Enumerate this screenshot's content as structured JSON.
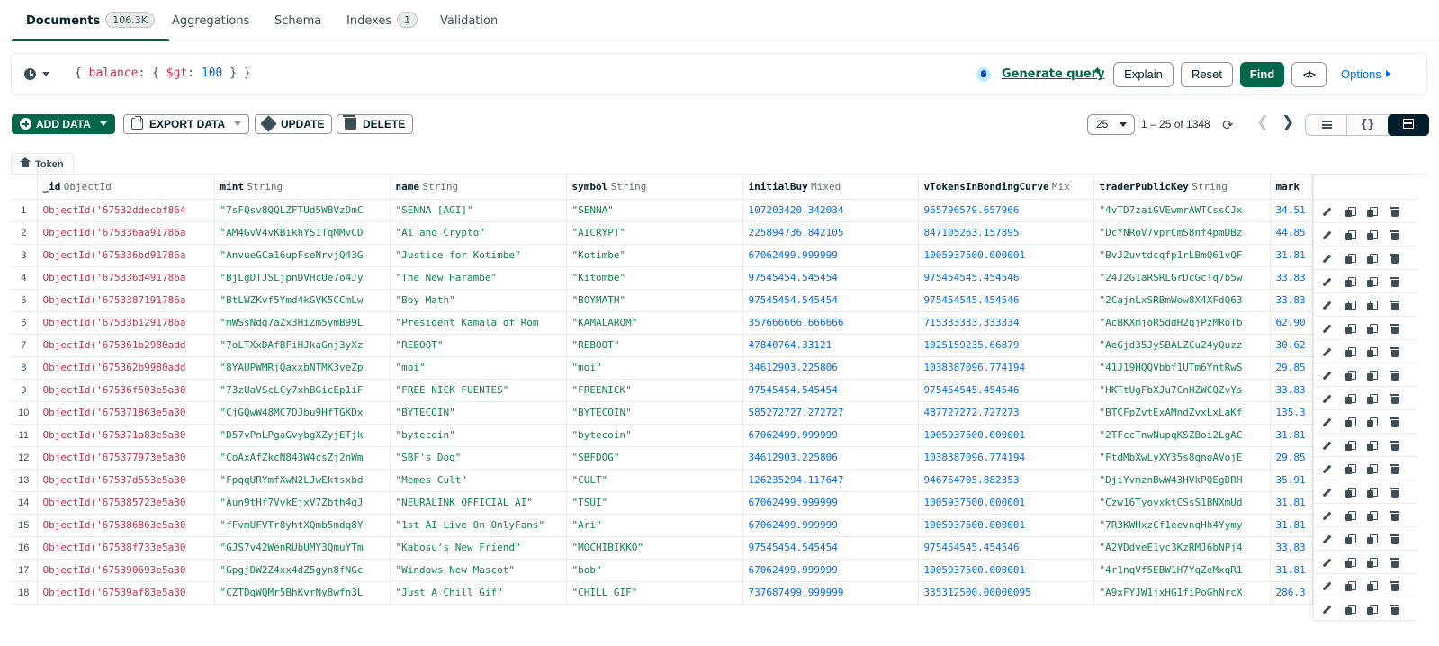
{
  "tabs": [
    {
      "label": "Documents",
      "count": "106.3K"
    },
    {
      "label": "Aggregations"
    },
    {
      "label": "Schema"
    },
    {
      "label": "Indexes",
      "count": "1"
    },
    {
      "label": "Validation"
    }
  ],
  "query": {
    "open": "{ ",
    "field": "balance",
    "colon": ": { ",
    "op": "$gt",
    "colon2": ": ",
    "value": "100",
    "close": " } }",
    "generate_label": "Generate query",
    "explain_label": "Explain",
    "reset_label": "Reset",
    "find_label": "Find",
    "options_label": "Options"
  },
  "toolbar": {
    "add_label": "ADD DATA",
    "export_label": "EXPORT DATA",
    "update_label": "UPDATE",
    "delete_label": "DELETE",
    "page_size": "25",
    "range": "1 – 25 of 1348"
  },
  "breadcrumb": "Token",
  "columns": [
    {
      "field": "_id",
      "type": "ObjectId"
    },
    {
      "field": "mint",
      "type": "String"
    },
    {
      "field": "name",
      "type": "String"
    },
    {
      "field": "symbol",
      "type": "String"
    },
    {
      "field": "initialBuy",
      "type": "Mixed"
    },
    {
      "field": "vTokensInBondingCurve",
      "type": "Mix"
    },
    {
      "field": "traderPublicKey",
      "type": "String"
    },
    {
      "field": "mark",
      "type": ""
    }
  ],
  "rows": [
    [
      "1",
      "ObjectId('67532ddecbf864",
      "\"7sFQsv8QQLZFTUd5WBVzDmC",
      "\"SENNA [AGI]\"",
      "\"SENNA\"",
      "107203420.342034",
      "965796579.657966",
      "\"4vTD7zaiGVEwmrAWTCssCJx",
      "34.51"
    ],
    [
      "2",
      "ObjectId('675336aa91786a",
      "\"AM4GvV4vKBikhYS1TqMMvCD",
      "\"AI and Crypto\"",
      "\"AICRYPT\"",
      "225894736.842105",
      "847105263.157895",
      "\"DcYNRoV7vprCmS8nf4pmDBz",
      "44.85"
    ],
    [
      "3",
      "ObjectId('675336bd91786a",
      "\"AnvueGCa16upFseNrvjQ43G",
      "\"Justice for Kotimbe\"",
      "\"Kotimbe\"",
      "67062499.999999",
      "1005937500.000001",
      "\"BvJ2uvtdcqfp1rLBmQ61vQF",
      "31.81"
    ],
    [
      "4",
      "ObjectId('675336d491786a",
      "\"BjLgDTJSLjpnDVHcUe7o4Jy",
      "\"The New Harambe\"",
      "\"Kitombe\"",
      "97545454.545454",
      "975454545.454546",
      "\"24J2G1aRSRLGrDcGcTq7b5w",
      "33.83"
    ],
    [
      "5",
      "ObjectId('6753387191786a",
      "\"BtLWZKvf5Ymd4kGVK5CCmLw",
      "\"Boy Math\"",
      "\"BOYMATH\"",
      "97545454.545454",
      "975454545.454546",
      "\"2CajnLxSRBmWow8X4XFdQ63",
      "33.83"
    ],
    [
      "6",
      "ObjectId('67533b1291786a",
      "\"mWSsNdg7aZx3HiZm5ymB99L",
      "\"President Kamala of Rom",
      "\"KAMALAROM\"",
      "357666666.666666",
      "715333333.333334",
      "\"AcBKXmjoR5ddH2qjPzMRoTb",
      "62.90"
    ],
    [
      "7",
      "ObjectId('675361b2980add",
      "\"7oLTXxDAfBFiHJkaGnj3yXz",
      "\"REBOOT\"",
      "\"REBOOT\"",
      "47840764.33121",
      "1025159235.66879",
      "\"AeGjd35JySBALZCu24yQuzz",
      "30.62"
    ],
    [
      "8",
      "ObjectId('675362b9980add",
      "\"8YAUPWMRjQaxxbNTMK3veZp",
      "\"moi\"",
      "\"moi\"",
      "34612903.225806",
      "1038387096.774194",
      "\"41J19HQQVbbf1UTm6YntRwS",
      "29.85"
    ],
    [
      "9",
      "ObjectId('67536f503e5a30",
      "\"73zUaVScLCy7xhBGicEp1iF",
      "\"FREE NICK FUENTES\"",
      "\"FREENICK\"",
      "97545454.545454",
      "975454545.454546",
      "\"HKTtUgFbXJu7CnHZWCQZvYs",
      "33.83"
    ],
    [
      "10",
      "ObjectId('675371863e5a30",
      "\"CjGQwW48MC7DJbu9HfTGKDx",
      "\"BYTECOIN\"",
      "\"BYTECOIN\"",
      "585272727.272727",
      "487727272.727273",
      "\"BTCFpZvtExAMndZvxLxLaKf",
      "135.3"
    ],
    [
      "11",
      "ObjectId('675371a83e5a30",
      "\"D57vPnLPgaGvybgXZyjETjk",
      "\"bytecoin\"",
      "\"bytecoin\"",
      "67062499.999999",
      "1005937500.000001",
      "\"2TFccTnwNupqKSZBoi2LgAC",
      "31.81"
    ],
    [
      "12",
      "ObjectId('675377973e5a30",
      "\"CoAxAfZkcN843W4csZj2nWm",
      "\"SBF's Dog\"",
      "\"SBFDOG\"",
      "34612903.225806",
      "1038387096.774194",
      "\"FtdMbXwLyXY35s8gnoAVojE",
      "29.85"
    ],
    [
      "13",
      "ObjectId('67537d553e5a30",
      "\"FpqqURYmfXwN2LJwEktsxbd",
      "\"Memes Cult\"",
      "\"CULT\"",
      "126235294.117647",
      "946764705.882353",
      "\"DjiYvmznBwW43HVkPQEgDRH",
      "35.91"
    ],
    [
      "14",
      "ObjectId('675385723e5a30",
      "\"Aun9tHf7VvkEjxV7Zbth4gJ",
      "\"NEURALINK OFFICIAL AI\"",
      "\"TSUI\"",
      "67062499.999999",
      "1005937500.000001",
      "\"Czw16TyoyxktCSsS1BNXmUd",
      "31.81"
    ],
    [
      "15",
      "ObjectId('675386863e5a30",
      "\"fFvmUFVTr8yhtXQmb5mdq8Y",
      "\"1st AI Live On OnlyFans\"",
      "\"Ari\"",
      "67062499.999999",
      "1005937500.000001",
      "\"7R3KWHxzCf1eevnqHh4Yymy",
      "31.81"
    ],
    [
      "16",
      "ObjectId('67538f733e5a30",
      "\"GJS7v42WenRUbUMY3QmuYTm",
      "\"Kabosu's New Friend\"",
      "\"MOCHIBIKKO\"",
      "97545454.545454",
      "975454545.454546",
      "\"A2VDdveE1vc3KzRMJ6bNPj4",
      "33.83"
    ],
    [
      "17",
      "ObjectId('675390693e5a30",
      "\"GpgjDW2Z4xx4dZ5gyn8fNGc",
      "\"Windows New Mascot\"",
      "\"bob\"",
      "67062499.999999",
      "1005937500.000001",
      "\"4r1nqVf5EBW1H7YqZeMxqR1",
      "31.81"
    ],
    [
      "18",
      "ObjectId('67539af83e5a30",
      "\"CZTDgWQMr5BhKvrNy8wfn3L",
      "\"Just A Chill Gif\"",
      "\"CHILL GIF\"",
      "737687499.999999",
      "335312500.00000095",
      "\"A9xFYJW1jxHG1fiPoGhNrcX",
      "286.3"
    ]
  ]
}
